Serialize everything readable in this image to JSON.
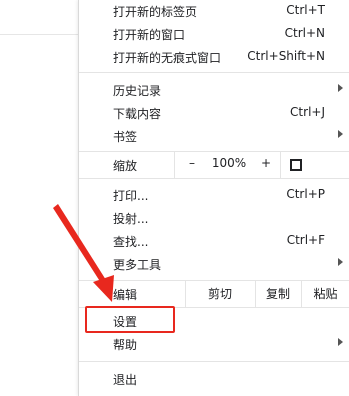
{
  "menu": {
    "top_items": [
      {
        "label": "打开新的标签页",
        "shortcut": "Ctrl+T"
      },
      {
        "label": "打开新的窗口",
        "shortcut": "Ctrl+N"
      },
      {
        "label": "打开新的无痕式窗口",
        "shortcut": "Ctrl+Shift+N"
      }
    ],
    "history": {
      "label": "历史记录"
    },
    "downloads": {
      "label": "下载内容",
      "shortcut": "Ctrl+J"
    },
    "bookmarks": {
      "label": "书签"
    },
    "zoom": {
      "label": "缩放",
      "minus": "–",
      "value": "100%",
      "plus": "+"
    },
    "print": {
      "label": "打印...",
      "shortcut": "Ctrl+P"
    },
    "cast": {
      "label": "投射..."
    },
    "find": {
      "label": "查找...",
      "shortcut": "Ctrl+F"
    },
    "more_tools": {
      "label": "更多工具"
    },
    "edit": {
      "label": "编辑",
      "cut": "剪切",
      "copy": "复制",
      "paste": "粘贴"
    },
    "settings": {
      "label": "设置"
    },
    "help": {
      "label": "帮助"
    },
    "exit": {
      "label": "退出"
    }
  },
  "annotation_color": "#e8281e"
}
